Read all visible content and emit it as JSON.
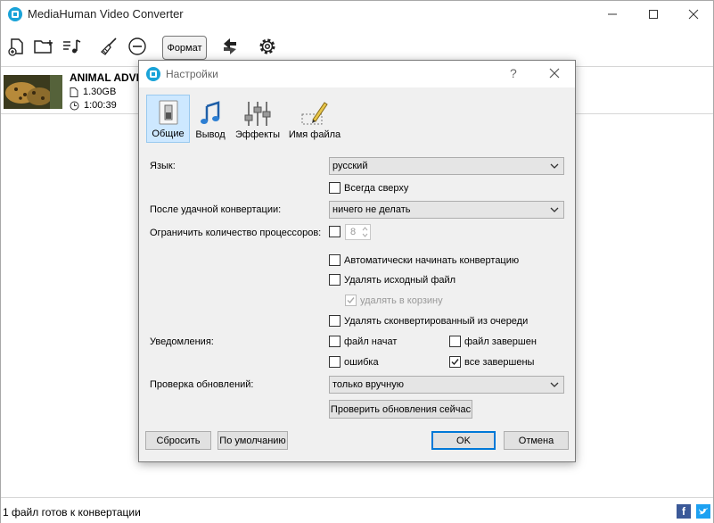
{
  "app": {
    "title": "MediaHuman Video Converter",
    "toolbar": {
      "format_label": "Формат"
    },
    "file": {
      "name": "ANIMAL ADVE",
      "size": "1.30GB",
      "duration": "1:00:39"
    },
    "status_text": "1 файл готов к конвертации",
    "colors": {
      "accent": "#0078d7",
      "facebook": "#3b5998",
      "twitter": "#1da1f2"
    }
  },
  "dialog": {
    "title": "Настройки",
    "help": "?",
    "tabs": [
      {
        "label": "Общие",
        "icon": "switch-icon",
        "active": true
      },
      {
        "label": "Вывод",
        "icon": "music-note-icon",
        "active": false
      },
      {
        "label": "Эффекты",
        "icon": "sliders-icon",
        "active": false
      },
      {
        "label": "Имя файла",
        "icon": "pencil-icon",
        "active": false
      }
    ],
    "language": {
      "label": "Язык:",
      "value": "русский"
    },
    "always_on_top": {
      "label": "Всегда сверху",
      "checked": false
    },
    "after_conversion": {
      "label": "После удачной конвертации:",
      "value": "ничего не делать"
    },
    "limit_cpu": {
      "label": "Ограничить количество процессоров:",
      "checked": false,
      "value": "8"
    },
    "auto_start": {
      "label": "Автоматически начинать конвертацию",
      "checked": false
    },
    "delete_source": {
      "label": "Удалять исходный файл",
      "checked": false
    },
    "to_trash": {
      "label": "удалять в корзину",
      "checked": true,
      "enabled": false
    },
    "remove_converted": {
      "label": "Удалять сконвертированный из очереди",
      "checked": false
    },
    "notifications": {
      "label": "Уведомления:",
      "file_started": {
        "label": "файл начат",
        "checked": false
      },
      "file_finished": {
        "label": "файл завершен",
        "checked": false
      },
      "error": {
        "label": "ошибка",
        "checked": false
      },
      "all_finished": {
        "label": "все завершены",
        "checked": true
      }
    },
    "updates": {
      "label": "Проверка обновлений:",
      "value": "только вручную",
      "check_now": "Проверить обновления сейчас"
    },
    "buttons": {
      "reset": "Сбросить",
      "defaults": "По умолчанию",
      "ok": "OK",
      "cancel": "Отмена"
    }
  }
}
